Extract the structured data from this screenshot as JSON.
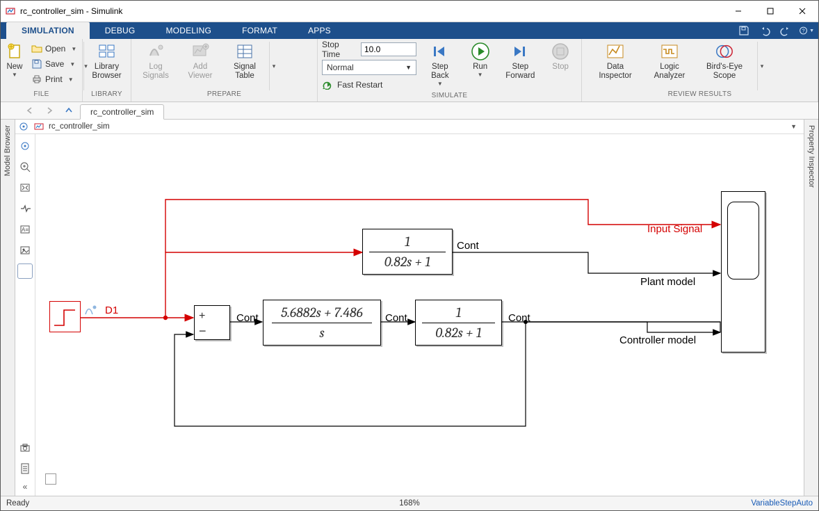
{
  "window": {
    "title": "rc_controller_sim - Simulink"
  },
  "tabs": {
    "items": [
      "SIMULATION",
      "DEBUG",
      "MODELING",
      "FORMAT",
      "APPS"
    ],
    "active": 0
  },
  "file_section": {
    "new": "New",
    "open": "Open",
    "save": "Save",
    "print": "Print",
    "label": "FILE"
  },
  "library_section": {
    "browser": "Library\nBrowser",
    "label": "LIBRARY"
  },
  "prepare_section": {
    "log_signals": "Log\nSignals",
    "add_viewer": "Add\nViewer",
    "signal_table": "Signal\nTable",
    "label": "PREPARE"
  },
  "simulate_section": {
    "stop_time_label": "Stop Time",
    "stop_time_value": "10.0",
    "mode": "Normal",
    "fast_restart": "Fast Restart",
    "step_back": "Step\nBack",
    "run": "Run",
    "step_forward": "Step\nForward",
    "stop": "Stop",
    "label": "SIMULATE"
  },
  "review_section": {
    "data_inspector": "Data\nInspector",
    "logic_analyzer": "Logic\nAnalyzer",
    "birdseye": "Bird's-Eye\nScope",
    "label": "REVIEW RESULTS"
  },
  "explorer": {
    "model_tab": "rc_controller_sim"
  },
  "breadcrumb": {
    "name": "rc_controller_sim"
  },
  "side_panels": {
    "left": "Model Browser",
    "right": "Property Inspector"
  },
  "diagram": {
    "step_name": "D1",
    "cont1": "Cont",
    "cont2": "Cont",
    "cont3": "Cont",
    "cont4": "Cont",
    "input_signal": "Input Signal",
    "plant_model": "Plant model",
    "controller_model": "Controller model",
    "tf_plant": {
      "num": "1",
      "den": "0.82s + 1"
    },
    "tf_ctrl": {
      "num": "5.6882s + 7.486",
      "den": "s"
    },
    "tf_plant2": {
      "num": "1",
      "den": "0.82s + 1"
    }
  },
  "status": {
    "left": "Ready",
    "zoom": "168%",
    "solver": "VariableStepAuto"
  }
}
